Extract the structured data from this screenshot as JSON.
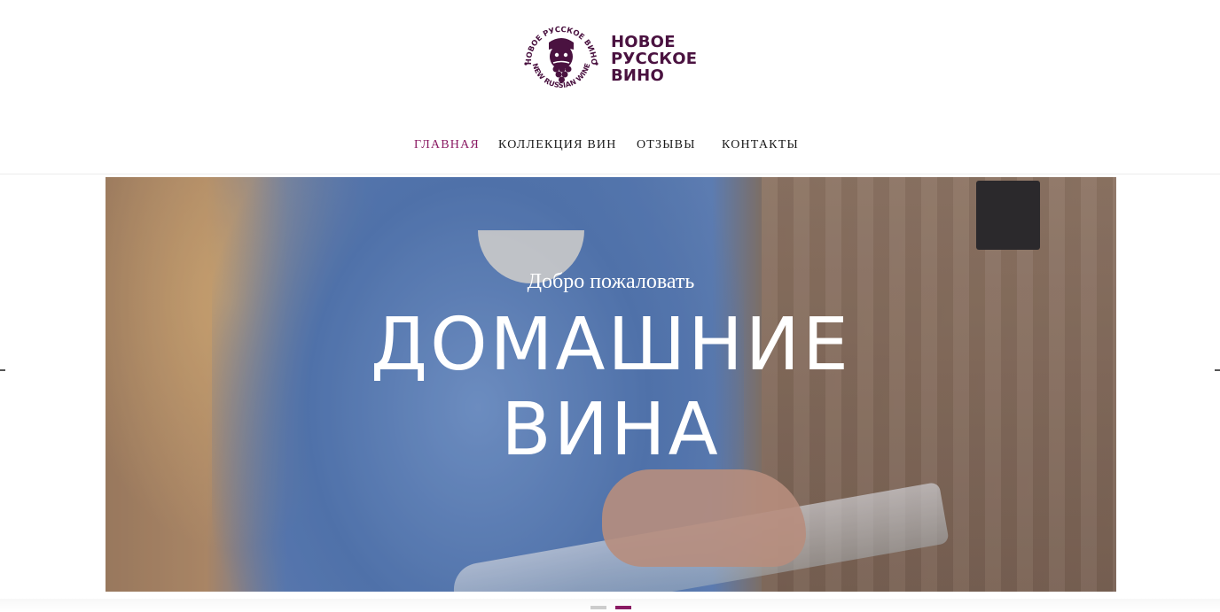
{
  "brand": {
    "name_lines": [
      "НОВОЕ",
      "РУССКОЕ",
      "ВИНО"
    ],
    "emblem_ring_top": "НОВОЕ РУССКОЕ ВИНО",
    "emblem_ring_bottom": "NEW RUSSIAN WINE",
    "color": "#4a1240"
  },
  "nav": {
    "items": [
      {
        "label": "ГЛАВНАЯ",
        "active": true
      },
      {
        "label": "КОЛЛЕКЦИЯ ВИН",
        "active": false
      },
      {
        "label": "ОТЗЫВЫ",
        "active": false
      },
      {
        "label": "КОНТАКТЫ",
        "active": false
      }
    ],
    "active_color": "#8a1a63"
  },
  "hero": {
    "welcome": "Добро пожаловать",
    "title_lines": [
      "ДОМАШНИЕ",
      "ВИНА"
    ]
  },
  "slider": {
    "prev_icon": "chevron-left-icon",
    "next_icon": "chevron-right-icon",
    "dots": [
      {
        "active": false,
        "color": "#cccccc"
      },
      {
        "active": true,
        "color": "#8a1a63"
      }
    ]
  }
}
